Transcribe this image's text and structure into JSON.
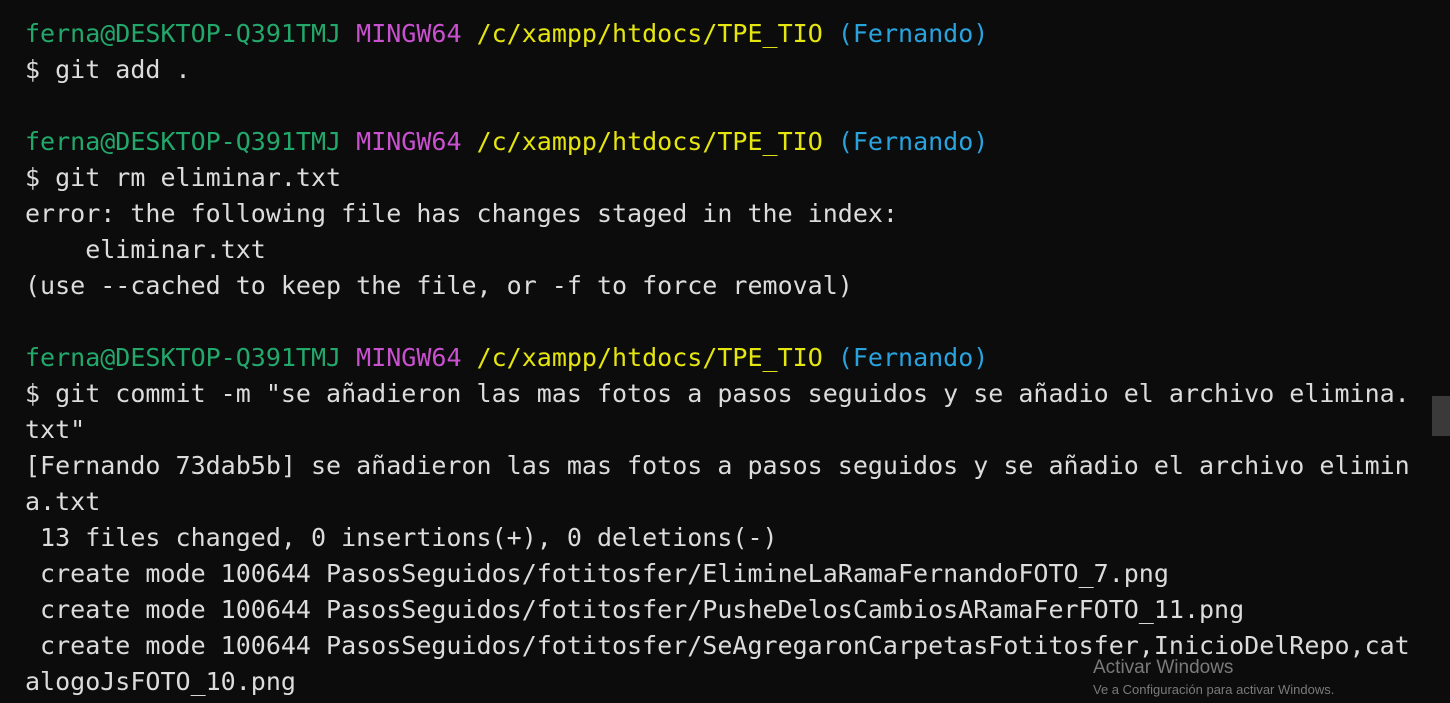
{
  "colors": {
    "background": "#0c0c0c",
    "user_host": "#23a86b",
    "system": "#c950cf",
    "path": "#e5e510",
    "branch": "#29a3dd",
    "text": "#dcdcdc"
  },
  "prompt": {
    "user_host": "ferna@DESKTOP-Q391TMJ",
    "system": "MINGW64",
    "path": "/c/xampp/htdocs/TPE_TIO",
    "branch": "(Fernando)"
  },
  "block1": {
    "command": "$ git add ."
  },
  "block2": {
    "command": "$ git rm eliminar.txt",
    "output": [
      "error: the following file has changes staged in the index:",
      "    eliminar.txt",
      "(use --cached to keep the file, or -f to force removal)"
    ]
  },
  "block3": {
    "command_lines": [
      "$ git commit -m \"se añadieron las mas fotos a pasos seguidos y se añadio el archivo elimina.",
      "txt\""
    ],
    "output": [
      "[Fernando 73dab5b] se añadieron las mas fotos a pasos seguidos y se añadio el archivo elimin",
      "a.txt",
      " 13 files changed, 0 insertions(+), 0 deletions(-)",
      " create mode 100644 PasosSeguidos/fotitosfer/ElimineLaRamaFernandoFOTO_7.png",
      " create mode 100644 PasosSeguidos/fotitosfer/PusheDelosCambiosARamaFerFOTO_11.png",
      " create mode 100644 PasosSeguidos/fotitosfer/SeAgregaronCarpetasFotitosfer,InicioDelRepo,cat",
      "alogoJsFOTO_10.png"
    ]
  },
  "watermark": {
    "title": "Activar Windows",
    "subtitle": "Ve a Configuración para activar Windows."
  }
}
